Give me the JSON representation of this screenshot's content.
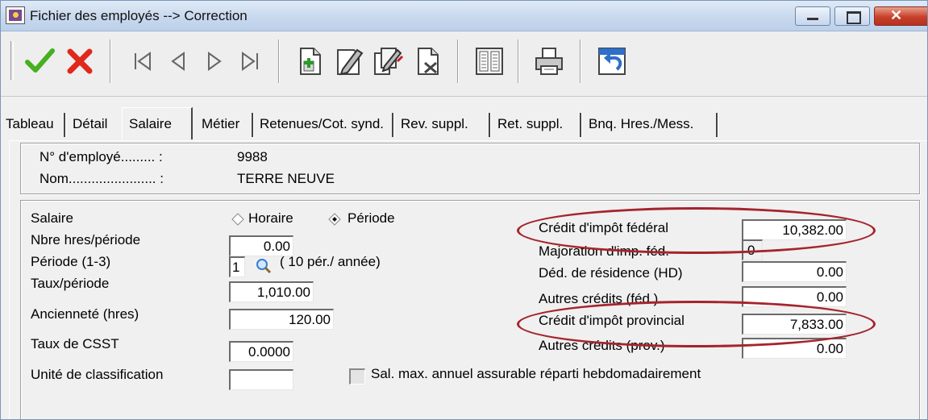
{
  "window": {
    "title": "Fichier des employés --> Correction"
  },
  "toolbar": {
    "icons": [
      "check-icon",
      "cancel-icon",
      "first-record-icon",
      "previous-record-icon",
      "next-record-icon",
      "last-record-icon",
      "new-document-icon",
      "edit-document-icon",
      "edit-multiple-icon",
      "delete-document-icon",
      "list-icon",
      "print-icon",
      "undo-icon"
    ]
  },
  "tabs": [
    "Tableau",
    "Détail",
    "Salaire",
    "Métier",
    "Retenues/Cot. synd.",
    "Rev. suppl.",
    "Ret. suppl.",
    "Bnq. Hres./Mess."
  ],
  "active_tab": "Salaire",
  "employee": {
    "number_label": "N° d'employé......... :",
    "number_value": "9988",
    "name_label": "Nom....................... :",
    "name_value": "TERRE NEUVE"
  },
  "salary": {
    "salaire_label": "Salaire",
    "option_horaire": "Horaire",
    "option_periode": "Période",
    "selected_option": "Période",
    "hres_label": "Nbre hres/période",
    "hres_value": "0.00",
    "periode_label": "Période (1-3)",
    "periode_value": "1",
    "periode_note": "( 10  pér./ année)",
    "taux_label": "Taux/période",
    "taux_value": "1,010.00",
    "anciennete_label": "Ancienneté (hres)",
    "anciennete_value": "120.00",
    "csst_label": "Taux de CSST",
    "csst_value": "0.0000",
    "unite_label": "Unité de classification",
    "unite_value": "",
    "salmax_label": "Sal. max. annuel assurable réparti hebdomadairement"
  },
  "credits": {
    "fed_label": "Crédit d'impôt fédéral",
    "fed_value": "10,382.00",
    "majoration_label": "Majoration d'imp. féd.",
    "majoration_value": "0",
    "residence_label": "Déd. de résidence (HD)",
    "residence_value": "0.00",
    "autres_fed_label": "Autres crédits (féd.)",
    "autres_fed_value": "0.00",
    "prov_label": "Crédit d'impôt provincial",
    "prov_value": "7,833.00",
    "autres_prov_label": "Autres crédits (prov.)",
    "autres_prov_value": "0.00"
  },
  "colors": {
    "highlight": "#a5242c"
  }
}
